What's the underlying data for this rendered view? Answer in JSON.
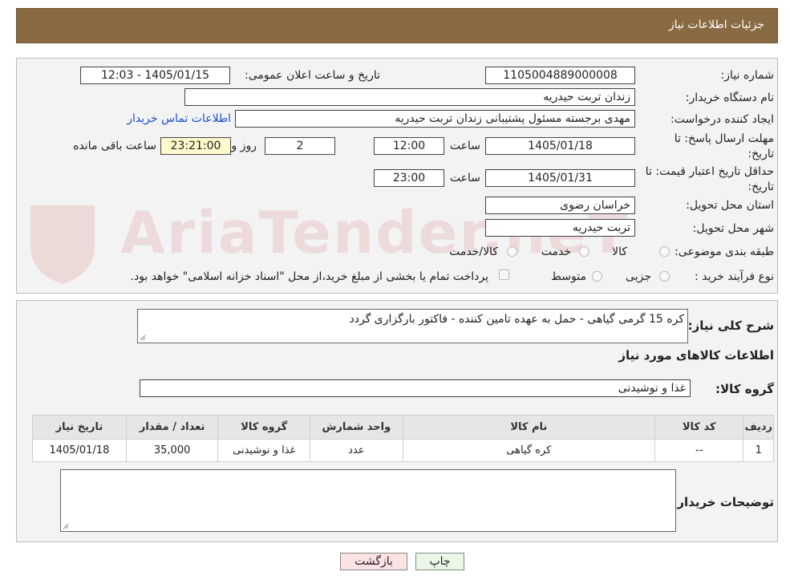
{
  "header": {
    "title": "جزئیات اطلاعات نیاز"
  },
  "form": {
    "need_number_label": "شماره نیاز:",
    "need_number": "1105004889000008",
    "announce_label": "تاریخ و ساعت اعلان عمومی:",
    "announce_value": "1405/01/15 - 12:03",
    "buyer_org_label": "نام دستگاه خریدار:",
    "buyer_org": "زندان تربت حیدریه",
    "creator_label": "ایجاد کننده درخواست:",
    "creator": "مهدی برجسته مسئول پشتیبانی زندان تربت حیدریه",
    "contact_link": "اطلاعات تماس خریدار",
    "deadline_label_1": "مهلت ارسال پاسخ: تا",
    "deadline_label_2": "تاریخ:",
    "deadline_date": "1405/01/18",
    "time_label": "ساعت",
    "deadline_time": "12:00",
    "days_value": "2",
    "days_label": "روز و",
    "remaining_time": "23:21:00",
    "remaining_label": "ساعت باقی مانده",
    "validity_label_1": "حداقل تاریخ اعتبار قیمت: تا",
    "validity_label_2": "تاریخ:",
    "validity_date": "1405/01/31",
    "validity_time": "23:00",
    "province_label": "استان محل تحویل:",
    "province": "خراسان رضوی",
    "city_label": "شهر محل تحویل:",
    "city": "تربت حیدریه",
    "category_label": "طبقه بندی موضوعی:",
    "category_options": [
      "کالا",
      "خدمت",
      "کالا/خدمت"
    ],
    "process_label": "نوع فرآیند خرید :",
    "process_options": [
      "جزیی",
      "متوسط"
    ],
    "payment_note": "پرداخت تمام یا بخشی از مبلغ خرید،از محل \"اسناد خزانه اسلامی\" خواهد بود."
  },
  "details": {
    "description_label": "شرح کلی نیاز:",
    "description": "کره 15 گرمی گیاهی - حمل به عهده تامین کننده - فاکتور بارگزاری گردد",
    "goods_info_title": "اطلاعات کالاهای مورد نیاز",
    "goods_group_label": "گروه کالا:",
    "goods_group": "غذا و نوشیدنی",
    "table": {
      "headers": [
        "ردیف",
        "کد کالا",
        "نام کالا",
        "واحد شمارش",
        "گروه کالا",
        "تعداد / مقدار",
        "تاریخ نیاز"
      ],
      "rows": [
        [
          "1",
          "--",
          "کره گیاهی",
          "عدد",
          "غذا و نوشیدنی",
          "35,000",
          "1405/01/18"
        ]
      ]
    },
    "buyer_notes_label": "توضیحات خریدار:"
  },
  "buttons": {
    "print": "چاپ",
    "back": "بازگشت"
  },
  "watermark": "AriaTender.neT",
  "colors": {
    "header_bg": "#8a6a42",
    "link": "#1a4fd0"
  }
}
